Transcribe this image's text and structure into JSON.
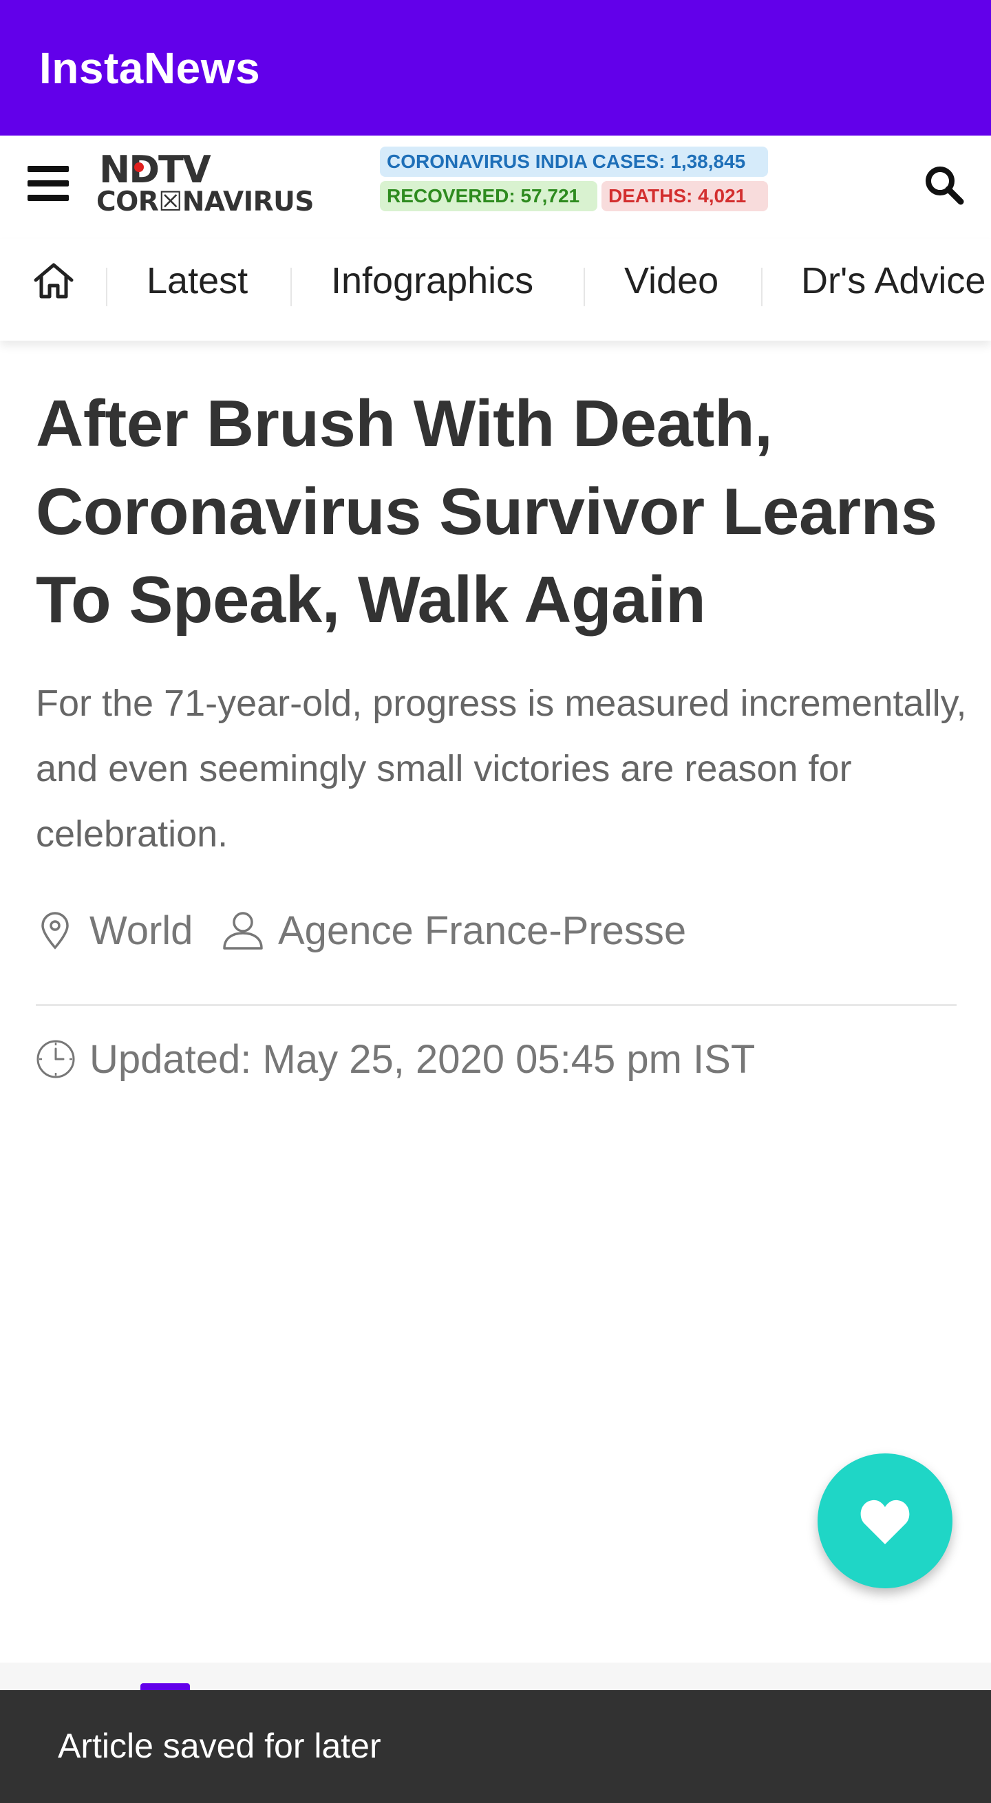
{
  "app": {
    "title": "InstaNews"
  },
  "header": {
    "logo_top": "NDTV",
    "logo_bottom": "COR☒NAVIRUS",
    "stats": {
      "cases": "CORONAVIRUS INDIA CASES: 1,38,845",
      "recovered": "RECOVERED: 57,721",
      "deaths": "DEATHS: 4,021"
    }
  },
  "nav": {
    "items": [
      {
        "label": "Latest"
      },
      {
        "label": "Infographics"
      },
      {
        "label": "Video"
      },
      {
        "label": "Dr's Advice"
      }
    ]
  },
  "article": {
    "headline": "After Brush With Death, Coronavirus Survivor Learns To Speak, Walk Again",
    "summary": "For the 71-year-old, progress is measured incrementally, and even seemingly small victories are reason for celebration.",
    "location": "World",
    "author": "Agence France-Presse",
    "updated": "Updated: May 25, 2020 05:45 pm IST"
  },
  "snackbar": {
    "message": "Article saved for later"
  },
  "colors": {
    "app_bar": "#6200ea",
    "fab": "#1fd6c6",
    "snackbar": "#323232",
    "cases_bg": "#d6ebfa",
    "recovered_bg": "#d9f2d0",
    "deaths_bg": "#f8dcdc"
  }
}
